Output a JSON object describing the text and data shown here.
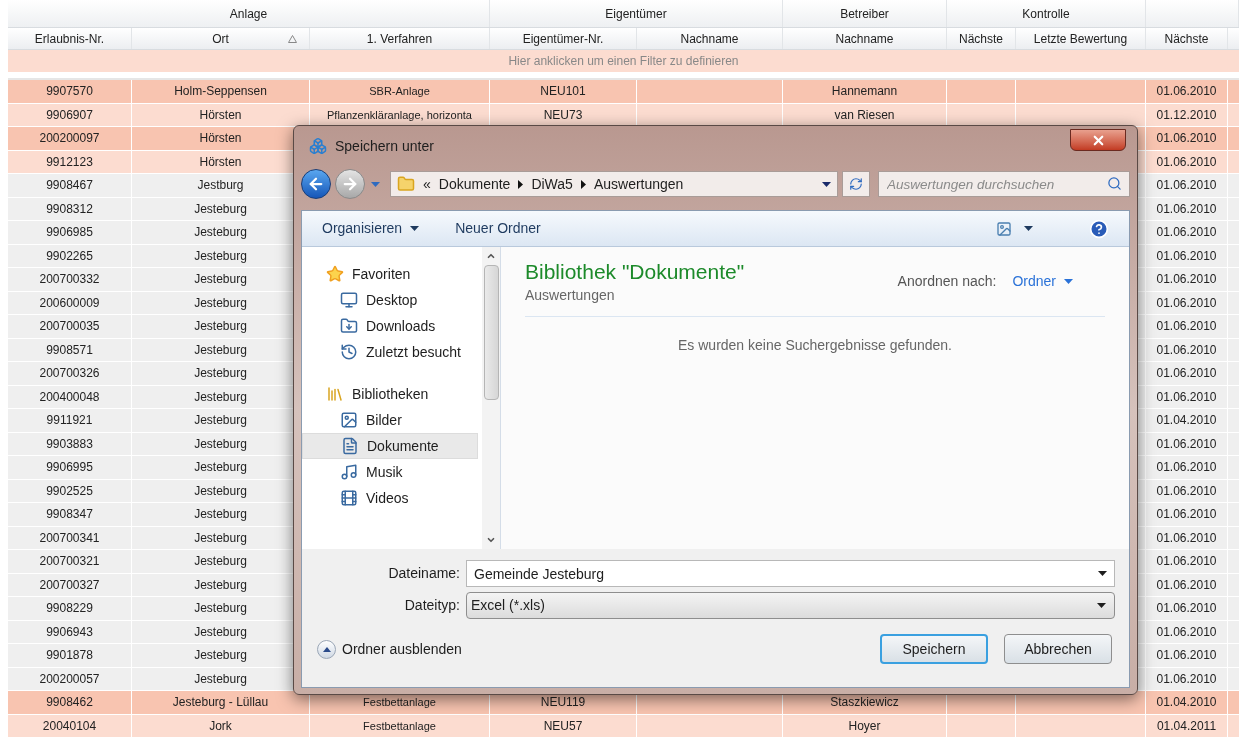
{
  "table": {
    "header_groups": [
      {
        "label": "Anlage",
        "columns": [
          {
            "label": "Erlaubnis-Nr.",
            "sorted": false
          },
          {
            "label": "Ort",
            "sorted": true
          },
          {
            "label": "1. Verfahren",
            "sorted": false
          }
        ]
      },
      {
        "label": "Eigentümer",
        "columns": [
          {
            "label": "Eigentümer-Nr.",
            "sorted": false
          },
          {
            "label": "Nachname",
            "sorted": false
          }
        ]
      },
      {
        "label": "Betreiber",
        "columns": [
          {
            "label": "Nachname",
            "sorted": false
          }
        ]
      },
      {
        "label": "Kontrolle",
        "columns": [
          {
            "label": "Nächste",
            "sorted": false
          },
          {
            "label": "Letzte Bewertung",
            "sorted": false
          }
        ]
      },
      {
        "columns": [
          {
            "label": "Nächste",
            "sorted": false
          }
        ]
      }
    ],
    "filter_hint": "Hier anklicken um einen Filter zu definieren",
    "rows": [
      {
        "color": "#f8c4b0",
        "erlaubnis_nr": "9907570",
        "ort": "Holm-Seppensen",
        "verfahren": "SBR-Anlage",
        "eigentuemer_nr": "NEU101",
        "betreiber_nachname": "Hannemann",
        "naechste": "01.06.2010"
      },
      {
        "color": "#fcdcd0",
        "erlaubnis_nr": "9906907",
        "ort": "Hörsten",
        "verfahren": "Pflanzenkläranlage, horizonta",
        "eigentuemer_nr": "NEU73",
        "betreiber_nachname": "van Riesen",
        "naechste": "01.12.2010"
      },
      {
        "color": "#f8c4b0",
        "erlaubnis_nr": "200200097",
        "ort": "Hörsten",
        "naechste": "01.06.2010"
      },
      {
        "color": "#fcdcd0",
        "erlaubnis_nr": "9912123",
        "ort": "Hörsten",
        "naechste": "01.06.2010"
      },
      {
        "color": "#efefef",
        "erlaubnis_nr": "9908467",
        "ort": "Jestburg",
        "naechste": "01.06.2010"
      },
      {
        "color": "#efefef",
        "erlaubnis_nr": "9908312",
        "ort": "Jesteburg",
        "naechste": "01.06.2010"
      },
      {
        "color": "#efefef",
        "erlaubnis_nr": "9906985",
        "ort": "Jesteburg",
        "naechste": "01.06.2010"
      },
      {
        "color": "#efefef",
        "erlaubnis_nr": "9902265",
        "ort": "Jesteburg",
        "naechste": "01.06.2010"
      },
      {
        "color": "#efefef",
        "erlaubnis_nr": "200700332",
        "ort": "Jesteburg",
        "naechste": "01.06.2010"
      },
      {
        "color": "#efefef",
        "erlaubnis_nr": "200600009",
        "ort": "Jesteburg",
        "naechste": "01.06.2010"
      },
      {
        "color": "#efefef",
        "erlaubnis_nr": "200700035",
        "ort": "Jesteburg",
        "naechste": "01.06.2010"
      },
      {
        "color": "#efefef",
        "erlaubnis_nr": "9908571",
        "ort": "Jesteburg",
        "naechste": "01.06.2010"
      },
      {
        "color": "#efefef",
        "erlaubnis_nr": "200700326",
        "ort": "Jesteburg",
        "naechste": "01.06.2010"
      },
      {
        "color": "#efefef",
        "erlaubnis_nr": "200400048",
        "ort": "Jesteburg",
        "naechste": "01.06.2010"
      },
      {
        "color": "#efefef",
        "erlaubnis_nr": "9911921",
        "ort": "Jesteburg",
        "naechste": "01.04.2010"
      },
      {
        "color": "#efefef",
        "erlaubnis_nr": "9903883",
        "ort": "Jesteburg",
        "naechste": "01.06.2010"
      },
      {
        "color": "#efefef",
        "erlaubnis_nr": "9906995",
        "ort": "Jesteburg",
        "naechste": "01.06.2010"
      },
      {
        "color": "#efefef",
        "erlaubnis_nr": "9902525",
        "ort": "Jesteburg",
        "naechste": "01.06.2010"
      },
      {
        "color": "#efefef",
        "erlaubnis_nr": "9908347",
        "ort": "Jesteburg",
        "naechste": "01.06.2010"
      },
      {
        "color": "#efefef",
        "erlaubnis_nr": "200700341",
        "ort": "Jesteburg",
        "naechste": "01.06.2010"
      },
      {
        "color": "#efefef",
        "erlaubnis_nr": "200700321",
        "ort": "Jesteburg",
        "naechste": "01.06.2010"
      },
      {
        "color": "#efefef",
        "erlaubnis_nr": "200700327",
        "ort": "Jesteburg",
        "naechste": "01.06.2010"
      },
      {
        "color": "#efefef",
        "erlaubnis_nr": "9908229",
        "ort": "Jesteburg",
        "naechste": "01.06.2010"
      },
      {
        "color": "#efefef",
        "erlaubnis_nr": "9906943",
        "ort": "Jesteburg",
        "naechste": "01.06.2010"
      },
      {
        "color": "#efefef",
        "erlaubnis_nr": "9901878",
        "ort": "Jesteburg",
        "naechste": "01.06.2010"
      },
      {
        "color": "#efefef",
        "erlaubnis_nr": "200200057",
        "ort": "Jesteburg",
        "naechste": "01.06.2010"
      },
      {
        "color": "#f8c4b0",
        "erlaubnis_nr": "9908462",
        "ort": "Jesteburg - Lüllau",
        "verfahren": "Festbettanlage",
        "eigentuemer_nr": "NEU119",
        "betreiber_nachname": "Staszkiewicz",
        "naechste": "01.04.2010"
      },
      {
        "color": "#fcdcd0",
        "erlaubnis_nr": "20040104",
        "ort": "Jork",
        "verfahren": "Festbettanlage",
        "eigentuemer_nr": "NEU57",
        "betreiber_nachname": "Hoyer",
        "naechste": "01.04.2011"
      }
    ]
  },
  "dialog": {
    "title": "Speichern unter",
    "breadcrumb_prefix": "«",
    "breadcrumbs": [
      "Dokumente",
      "DiWa5",
      "Auswertungen"
    ],
    "search": {
      "placeholder": "Auswertungen durchsuchen"
    },
    "toolbar": [
      {
        "label": "Organisieren",
        "kind": "menu"
      },
      {
        "label": "Neuer Ordner",
        "kind": "button"
      }
    ],
    "nav": [
      {
        "label": "Favoriten",
        "selected": false,
        "children": [
          {
            "label": "Desktop",
            "selected": false
          },
          {
            "label": "Downloads",
            "selected": false
          },
          {
            "label": "Zuletzt besucht",
            "selected": false
          }
        ]
      },
      {
        "label": "Bibliotheken",
        "selected": false,
        "children": [
          {
            "label": "Bilder",
            "selected": false
          },
          {
            "label": "Dokumente",
            "selected": true
          },
          {
            "label": "Musik",
            "selected": false
          },
          {
            "label": "Videos",
            "selected": false
          }
        ]
      }
    ],
    "library_title": "Bibliothek \"Dokumente\"",
    "library_subtitle": "Auswertungen",
    "arrange_label": "Anordnen nach:",
    "arrange_value": "Ordner",
    "empty_message": "Es wurden keine Suchergebnisse gefunden.",
    "filename": {
      "label": "Dateiname:",
      "value": "Gemeinde Jesteburg"
    },
    "filetype": {
      "label": "Dateityp:",
      "value": "Excel (*.xls)"
    },
    "folder_toggle": "Ordner ausblenden",
    "buttons": [
      {
        "label": "Speichern",
        "default": true
      },
      {
        "label": "Abbrechen",
        "default": false
      }
    ]
  }
}
